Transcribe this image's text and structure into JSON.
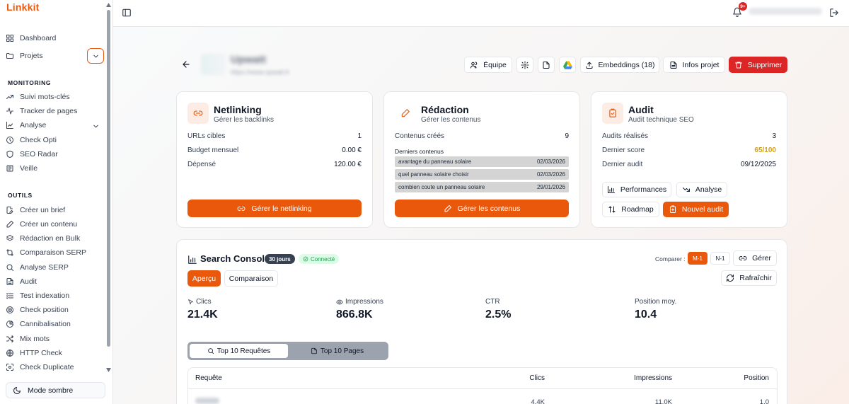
{
  "app": {
    "logo": "Linkkit"
  },
  "sidebar": {
    "top_items": [
      {
        "label": "Dashboard",
        "icon": "dashboard-icon"
      },
      {
        "label": "Projets",
        "icon": "folder-icon"
      }
    ],
    "monitoring_title": "MONITORING",
    "monitoring_items": [
      {
        "label": "Suivi mots-clés",
        "icon": "trending-up-icon"
      },
      {
        "label": "Tracker de pages",
        "icon": "activity-icon"
      },
      {
        "label": "Analyse",
        "icon": "chart-line-icon"
      },
      {
        "label": "Check Opti",
        "icon": "clock-icon"
      },
      {
        "label": "SEO Radar",
        "icon": "shield-icon"
      },
      {
        "label": "Veille",
        "icon": "newspaper-icon"
      }
    ],
    "outils_title": "OUTILS",
    "outils_items": [
      {
        "label": "Créer un brief",
        "icon": "file-pen-icon"
      },
      {
        "label": "Créer un contenu",
        "icon": "pen-icon"
      },
      {
        "label": "Rédaction en Bulk",
        "icon": "layers-icon"
      },
      {
        "label": "Comparaison SERP",
        "icon": "compare-icon"
      },
      {
        "label": "Analyse SERP",
        "icon": "search-icon"
      },
      {
        "label": "Audit",
        "icon": "file-text-icon"
      },
      {
        "label": "Test indexation",
        "icon": "list-check-icon"
      },
      {
        "label": "Check position",
        "icon": "target-icon"
      },
      {
        "label": "Cannibalisation",
        "icon": "chart-pie-icon"
      },
      {
        "label": "Mix mots",
        "icon": "shuffle-icon"
      },
      {
        "label": "HTTP Check",
        "icon": "globe-icon"
      },
      {
        "label": "Check Duplicate",
        "icon": "scan-icon"
      }
    ],
    "dark_mode_label": "Mode sombre"
  },
  "topbar": {
    "notification_count": "9+"
  },
  "header": {
    "buttons": {
      "team": "Équipe",
      "embeddings": "Embeddings (18)",
      "project_info": "Infos projet",
      "delete": "Supprimer"
    }
  },
  "netlinking": {
    "title": "Netlinking",
    "subtitle": "Gérer les backlinks",
    "stats": [
      {
        "label": "URLs cibles",
        "value": "1"
      },
      {
        "label": "Budget mensuel",
        "value": "0.00 €"
      },
      {
        "label": "Dépensé",
        "value": "120.00 €"
      }
    ],
    "action": "Gérer le netlinking"
  },
  "redaction": {
    "title": "Rédaction",
    "subtitle": "Gérer les contenus",
    "created_label": "Contenus créés",
    "created_value": "9",
    "recent_title": "Derniers contenus",
    "recent": [
      {
        "title": "avantage du panneau solaire",
        "date": "02/03/2026"
      },
      {
        "title": "quel panneau solaire choisir",
        "date": "02/03/2026"
      },
      {
        "title": "combien coute un panneau solaire",
        "date": "29/01/2026"
      }
    ],
    "action": "Gérer les contenus"
  },
  "audit": {
    "title": "Audit",
    "subtitle": "Audit technique SEO",
    "stats": [
      {
        "label": "Audits réalisés",
        "value": "3"
      },
      {
        "label": "Dernier score",
        "value": "65/100"
      },
      {
        "label": "Dernier audit",
        "value": "09/12/2025"
      }
    ],
    "score_color": "#d4a017",
    "buttons": {
      "performances": "Performances",
      "analyse": "Analyse",
      "roadmap": "Roadmap",
      "new_audit": "Nouvel audit"
    }
  },
  "search_console": {
    "title": "Search Console",
    "period_badge": "30 jours",
    "status_badge": "Connecté",
    "compare_label": "Comparer :",
    "compare_options": [
      "M-1",
      "N-1"
    ],
    "manage_label": "Gérer",
    "refresh_label": "Rafraîchir",
    "tabs": [
      "Aperçu",
      "Comparaison"
    ],
    "metrics": [
      {
        "label": "Clics",
        "value": "21.4K",
        "icon": "cursor-icon"
      },
      {
        "label": "Impressions",
        "value": "866.8K",
        "icon": "eye-icon"
      },
      {
        "label": "CTR",
        "value": "2.5%",
        "icon": ""
      },
      {
        "label": "Position moy.",
        "value": "10.4",
        "icon": ""
      }
    ],
    "segment": [
      "Top 10 Requêtes",
      "Top 10 Pages"
    ],
    "table": {
      "headers": [
        "Requête",
        "Clics",
        "Impressions",
        "Position"
      ],
      "rows": [
        {
          "query": "",
          "clicks": "4.4K",
          "impressions": "11.0K",
          "position": "1.0"
        }
      ]
    }
  },
  "colors": {
    "accent": "#ea580c",
    "danger": "#dc2626",
    "success": "#16a34a"
  }
}
